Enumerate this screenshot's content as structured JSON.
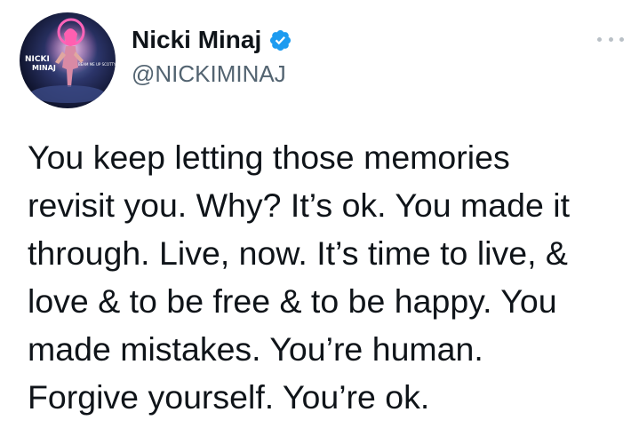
{
  "author": {
    "display_name": "Nicki Minaj",
    "handle": "@NICKIMINAJ",
    "verified": true,
    "avatar_icon": "album-cover-avatar-icon"
  },
  "tweet": {
    "lines": [
      "You keep letting those memories",
      "revisit you. Why? It’s ok. You made it",
      "through. Live, now. It’s time to live, &",
      "love & to be free & to be happy. You",
      "made mistakes. You’re human.",
      "Forgive yourself. You’re ok."
    ]
  },
  "menu": {
    "icon": "more-options-icon"
  },
  "colors": {
    "text": "#0f1419",
    "secondary": "#536471",
    "verified_badge": "#1d9bf0",
    "background": "#ffffff"
  }
}
